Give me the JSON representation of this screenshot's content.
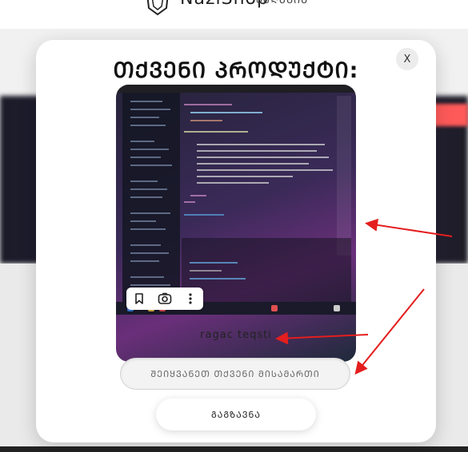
{
  "header": {
    "brand": "NaziShop",
    "subtitle": "ᲛᲐᲦᲐᲖᲘᲐ"
  },
  "modal": {
    "title": "ᲗᲥᲕᲔᲜᲘ ᲞᲠᲝᲓᲣᲥᲢᲘ:",
    "close_label": "X",
    "product_text": "ragac teqsti",
    "address_placeholder": "ᲨᲔᲘᲧᲕᲐᲜᲔᲗ ᲗᲥᲕᲔᲜᲘ ᲛᲘᲡᲐᲛᲐᲠᲗᲘ",
    "address_value": "",
    "send_label": "ᲒᲐᲒᲖᲐᲕᲜᲐ"
  },
  "image_toolbar": {
    "icons": [
      "bookmark-icon",
      "camera-lens-icon",
      "more-vertical-icon"
    ]
  },
  "colors": {
    "annotation_arrow": "#e41e1e",
    "modal_background": "#ffffff"
  }
}
